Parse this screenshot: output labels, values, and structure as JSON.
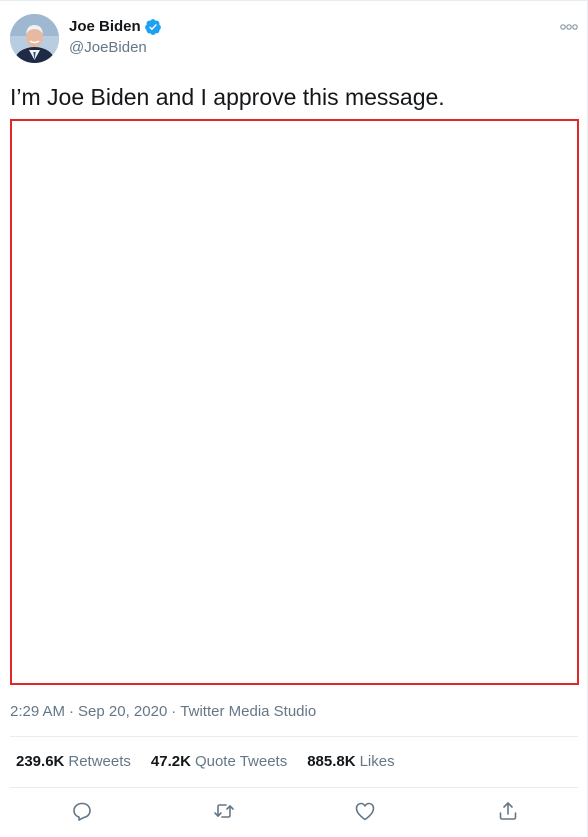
{
  "author": {
    "name": "Joe Biden",
    "handle": "@JoeBiden",
    "verified_icon": "verified-badge-icon",
    "avatar_icon": "profile-photo"
  },
  "tweet": {
    "text": "I’m Joe Biden and I approve this message.",
    "media_border_color": "#e0282a"
  },
  "meta": {
    "time": "2:29 AM",
    "date": "Sep 20, 2020",
    "separator": "·",
    "source": "Twitter Media Studio"
  },
  "stats": [
    {
      "count": "239.6K",
      "label": "Retweets"
    },
    {
      "count": "47.2K",
      "label": "Quote Tweets"
    },
    {
      "count": "885.8K",
      "label": "Likes"
    }
  ],
  "actions": [
    {
      "icon": "reply-icon"
    },
    {
      "icon": "retweet-icon"
    },
    {
      "icon": "like-heart-icon"
    },
    {
      "icon": "share-icon"
    }
  ],
  "colors": {
    "text": "#14171a",
    "secondary": "#657786",
    "brand": "#1da1f2"
  }
}
